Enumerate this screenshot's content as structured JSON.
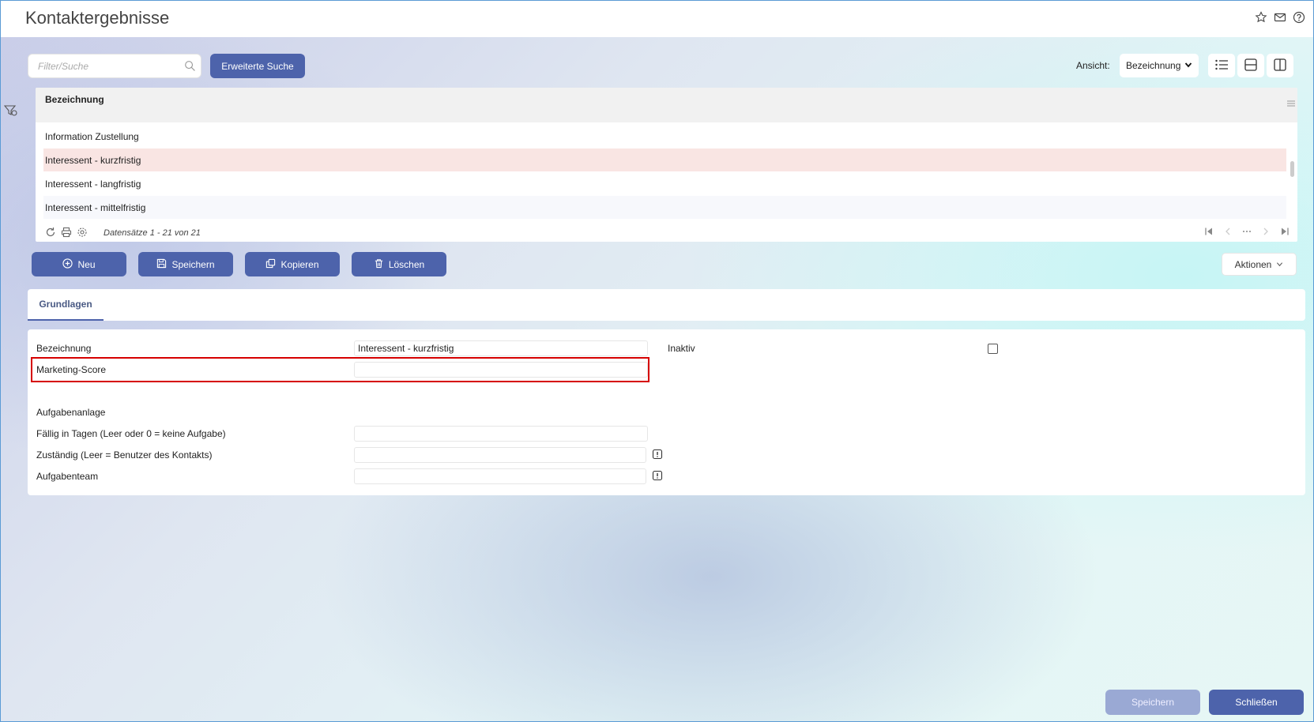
{
  "page": {
    "title": "Kontaktergebnisse"
  },
  "top_icons": [
    "star-icon",
    "mail-icon",
    "help-icon"
  ],
  "toolbar": {
    "search_placeholder": "Filter/Suche",
    "advanced_search_label": "Erweiterte Suche",
    "ansicht_label": "Ansicht:",
    "ansicht_value": "Bezeichnung"
  },
  "grid": {
    "column_header": "Bezeichnung",
    "rows": [
      {
        "label": "Information Zustellung",
        "state": "normal"
      },
      {
        "label": "Interessent - kurzfristig",
        "state": "selected"
      },
      {
        "label": "Interessent - langfristig",
        "state": "normal"
      },
      {
        "label": "Interessent - mittelfristig",
        "state": "alt"
      }
    ],
    "records_text": "Datensätze 1 - 21 von 21"
  },
  "actions": {
    "new_label": "Neu",
    "save_label": "Speichern",
    "copy_label": "Kopieren",
    "delete_label": "Löschen",
    "aktionen_label": "Aktionen"
  },
  "tabs": {
    "grundlagen": "Grundlagen"
  },
  "form": {
    "bezeichnung_label": "Bezeichnung",
    "bezeichnung_value": "Interessent - kurzfristig",
    "inaktiv_label": "Inaktiv",
    "inaktiv_checked": false,
    "marketing_score_label": "Marketing-Score",
    "marketing_score_value": "",
    "aufgabenanlage_label": "Aufgabenanlage",
    "faellig_label": "Fällig in Tagen (Leer oder 0 = keine Aufgabe)",
    "faellig_value": "",
    "zustaendig_label": "Zuständig (Leer = Benutzer des Kontakts)",
    "zustaendig_value": "",
    "aufgabenteam_label": "Aufgabenteam",
    "aufgabenteam_value": ""
  },
  "footer": {
    "save_label": "Speichern",
    "close_label": "Schließen"
  },
  "colors": {
    "primary": "#4d63ab",
    "selected_row": "#f9e5e3",
    "highlight": "#d60000"
  }
}
